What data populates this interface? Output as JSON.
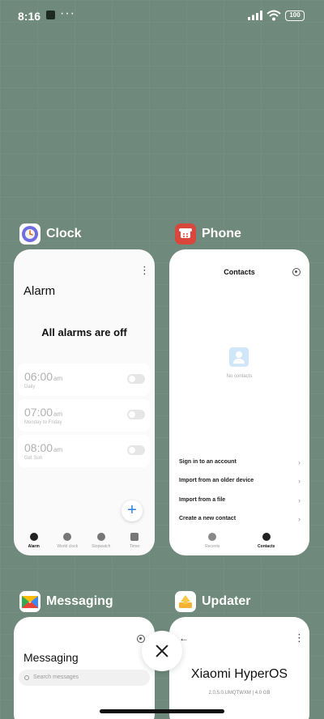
{
  "status_bar": {
    "time": "8:16",
    "notification_dots": "···",
    "battery": "100"
  },
  "apps": {
    "clock": {
      "name": "Clock",
      "screen": {
        "title": "Alarm",
        "empty_message": "All alarms are off",
        "alarms": [
          {
            "time": "06:00",
            "period": "am",
            "repeat": "Daily"
          },
          {
            "time": "07:00",
            "period": "am",
            "repeat": "Monday to Friday"
          },
          {
            "time": "08:00",
            "period": "am",
            "repeat": "Get Sun"
          }
        ],
        "add_button": "+",
        "tabs": [
          {
            "label": "Alarm",
            "active": true
          },
          {
            "label": "World clock",
            "active": false
          },
          {
            "label": "Stopwatch",
            "active": false
          },
          {
            "label": "Timer",
            "active": false
          }
        ]
      }
    },
    "phone": {
      "name": "Phone",
      "screen": {
        "title": "Contacts",
        "empty_message": "No contacts",
        "options": [
          "Sign in to an account",
          "Import from an older device",
          "Import from a file",
          "Create a new contact"
        ],
        "tabs": [
          {
            "label": "Recents",
            "active": false
          },
          {
            "label": "Contacts",
            "active": true
          }
        ]
      }
    },
    "messaging": {
      "name": "Messaging",
      "screen": {
        "title": "Messaging",
        "search_placeholder": "Search messages"
      }
    },
    "updater": {
      "name": "Updater",
      "screen": {
        "title": "Xiaomi HyperOS",
        "version": "2.0.5.0.UMQTWXM | 4.0 GB"
      }
    }
  },
  "colors": {
    "wallpaper": "#6f8a7c",
    "accent": "#2a7de1",
    "hyperos_blue": "#2a6fd6"
  }
}
